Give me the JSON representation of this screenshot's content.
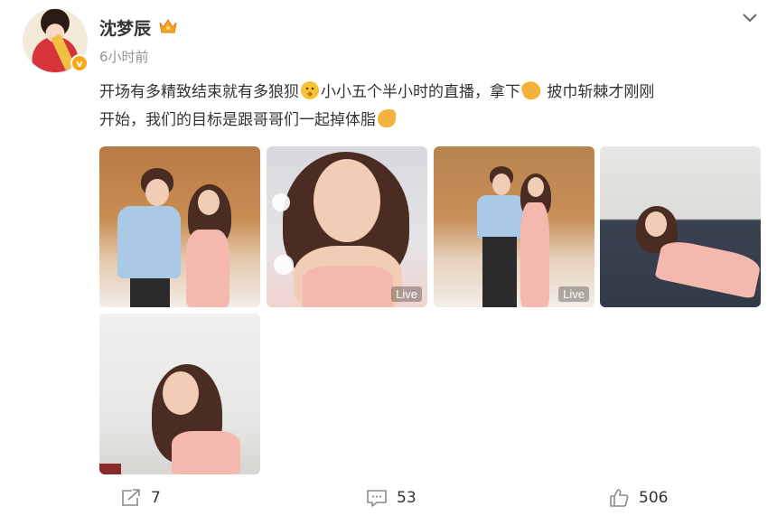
{
  "post": {
    "username": "沈梦辰",
    "timestamp": "6小时前",
    "verified_badge": "v",
    "text_line1_a": "开场有多精致结束就有多狼狈",
    "text_line1_b": "小小五个半小时的直播，拿下",
    "text_line1_c": "披巾斩棘才刚刚",
    "text_line2": "开始，我们的目标是跟哥哥们一起掉体脂",
    "emojis": [
      "thinking-face-emoji",
      "ok-hand-emoji",
      "muscle-emoji"
    ],
    "photos": [
      {
        "name": "photo-1",
        "live": false
      },
      {
        "name": "photo-2",
        "live": true,
        "live_label": "Live"
      },
      {
        "name": "photo-3",
        "live": true,
        "live_label": "Live"
      },
      {
        "name": "photo-4",
        "live": false
      },
      {
        "name": "photo-5",
        "live": false
      }
    ]
  },
  "actions": {
    "repost_count": "7",
    "comment_count": "53",
    "like_count": "506"
  },
  "colors": {
    "text": "#333333",
    "muted": "#939393",
    "icon": "#8a8a8a",
    "badge": "#f7a814"
  }
}
